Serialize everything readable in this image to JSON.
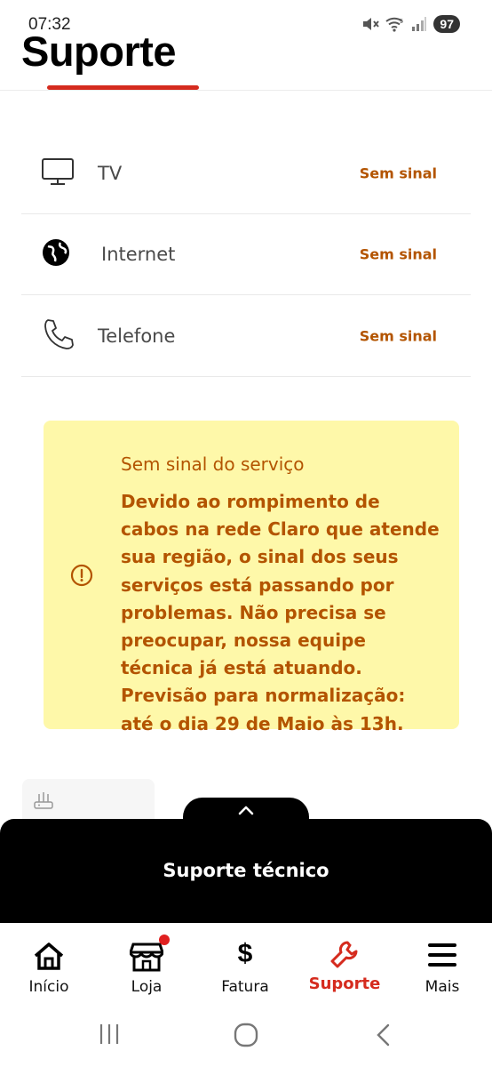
{
  "status_bar": {
    "time": "07:32",
    "battery": "97",
    "icons": [
      "mute-icon",
      "wifi-icon",
      "signal-icon"
    ]
  },
  "header": {
    "title": "Suporte"
  },
  "colors": {
    "accent": "#d52b1e",
    "warning_text": "#b35400",
    "alert_bg": "#fef8a9",
    "sheet_bg": "#000000"
  },
  "services": [
    {
      "label": "TV",
      "status": "Sem sinal",
      "icon": "tv-icon"
    },
    {
      "label": "Internet",
      "status": "Sem sinal",
      "icon": "globe-icon"
    },
    {
      "label": "Telefone",
      "status": "Sem sinal",
      "icon": "phone-icon"
    }
  ],
  "alert": {
    "title": "Sem sinal do serviço",
    "body": "Devido ao rompimento de cabos na rede Claro que atende sua região, o sinal dos seus serviços está passando por problemas. Não precisa se preocupar, nossa equipe técnica já está atuando. Previsão para normalização: até o dia 29 de Maio às 13h.",
    "icon": "alert-circle-icon"
  },
  "sheet": {
    "title": "Suporte técnico",
    "icon": "chevron-up-icon"
  },
  "bottom_nav": {
    "items": [
      {
        "label": "Início",
        "icon": "home-icon"
      },
      {
        "label": "Loja",
        "icon": "store-icon"
      },
      {
        "label": "Fatura",
        "icon": "dollar-icon"
      },
      {
        "label": "Suporte",
        "icon": "wrench-icon",
        "active": true
      },
      {
        "label": "Mais",
        "icon": "menu-icon"
      }
    ]
  },
  "system_nav": [
    "recents-icon",
    "home-circle-icon",
    "back-icon"
  ]
}
